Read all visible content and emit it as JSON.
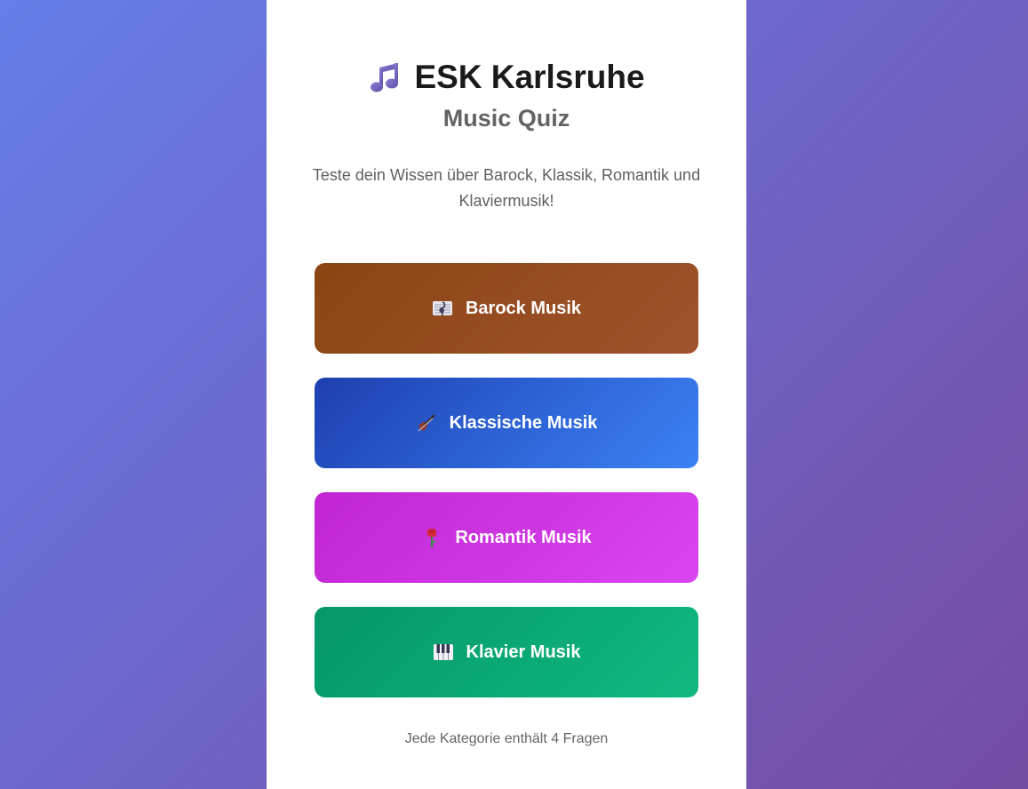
{
  "header": {
    "title": "ESK Karlsruhe",
    "title_icon": "music-notes-icon",
    "subtitle": "Music Quiz",
    "description": "Teste dein Wissen über Barock, Klassik, Romantik und Klaviermusik!"
  },
  "categories": [
    {
      "label": "Barock Musik",
      "icon": "sheet-music-icon",
      "color": "#8b4513"
    },
    {
      "label": "Klassische Musik",
      "icon": "violin-icon",
      "color": "#1e40af"
    },
    {
      "label": "Romantik Musik",
      "icon": "rose-icon",
      "color": "#c026d3"
    },
    {
      "label": "Klavier Musik",
      "icon": "piano-keys-icon",
      "color": "#059669"
    }
  ],
  "footer": {
    "note": "Jede Kategorie enthält 4 Fragen"
  }
}
